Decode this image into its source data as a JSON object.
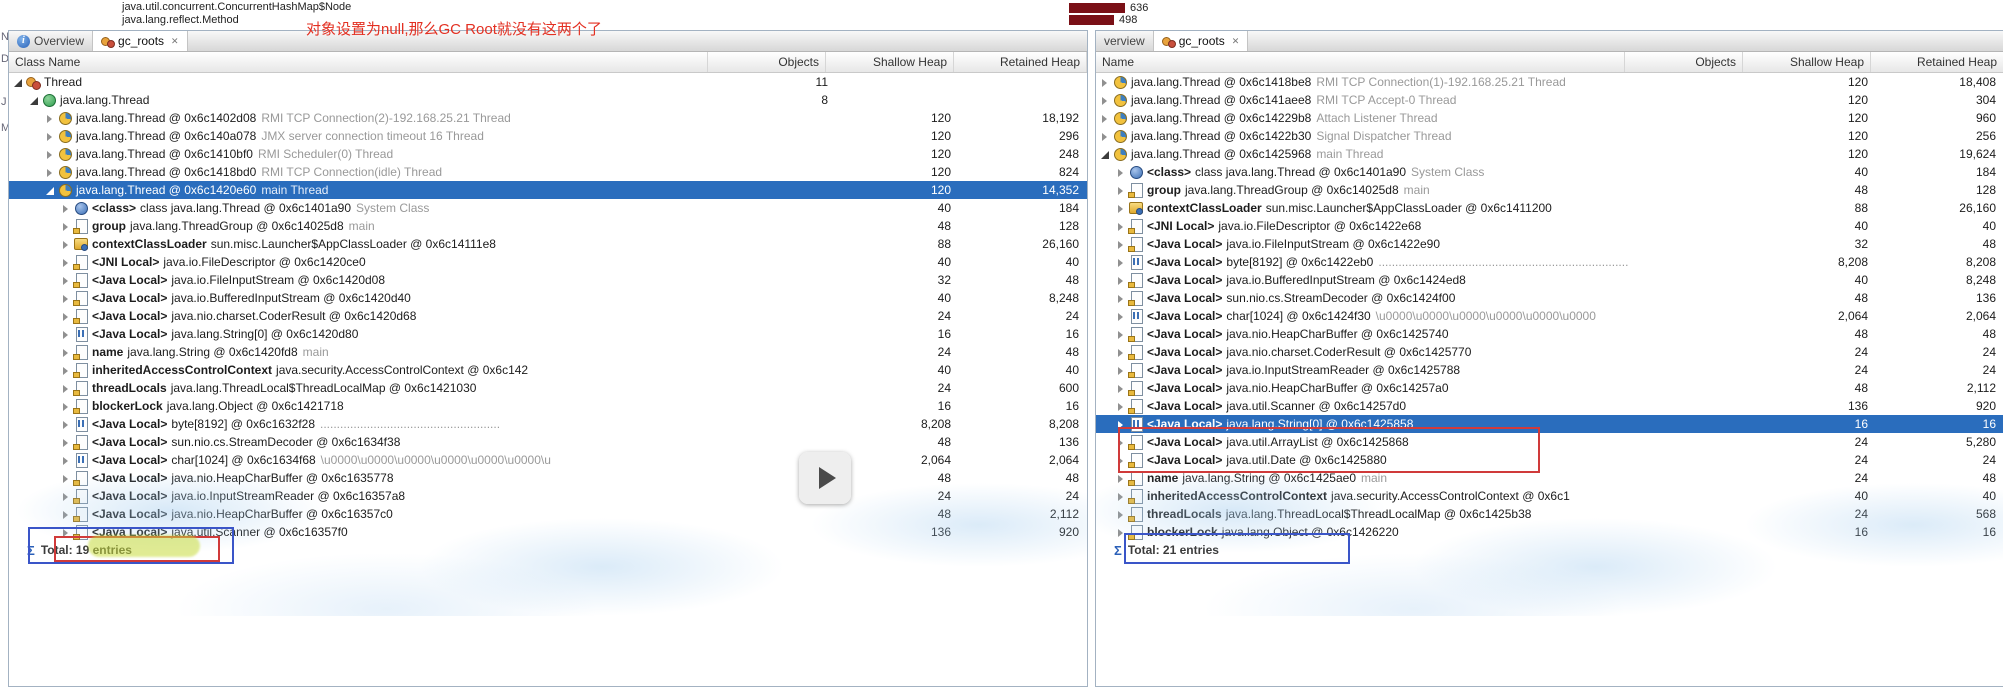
{
  "colors": {
    "selection": "#2a6dbd",
    "annotation_red": "#d03a3a",
    "annotation_blue": "#3a55c8",
    "highlight": "#c8dc3c",
    "bar": "#7a1016"
  },
  "glyphs": {
    "close": "✕",
    "sigma": "Σ"
  },
  "top_strip": {
    "overflow_rows": [
      "java.util.concurrent.ConcurrentHashMap$Node",
      "java.lang.reflect.Method"
    ],
    "annotation_cn": "对象设置为null,那么GC Root就没有这两个了",
    "histogram_bars": [
      {
        "value": "636"
      },
      {
        "value": "498"
      }
    ],
    "edge_letters": [
      "N",
      "D",
      "J",
      "M"
    ]
  },
  "left_panel": {
    "tabs": [
      {
        "label": "Overview",
        "icon": "info",
        "active": false,
        "closable": false
      },
      {
        "label": "gc_roots",
        "icon": "gcroots",
        "active": true,
        "closable": true
      }
    ],
    "columns": [
      "Class Name",
      "Objects",
      "Shallow Heap",
      "Retained Heap"
    ],
    "total_icon": "sigma",
    "total_label": "Total: 19 entries",
    "rows": [
      {
        "i": 0,
        "e": "e",
        "ic": "root",
        "t": "Thread",
        "o": "11"
      },
      {
        "i": 1,
        "e": "e",
        "ic": "jclass",
        "t": "java.lang.Thread",
        "o": "8"
      },
      {
        "i": 2,
        "e": "c",
        "ic": "thread",
        "t": "java.lang.Thread @ 0x6c1402d08",
        "s": "RMI TCP Connection(2)-192.168.25.21 Thread",
        "sh": "120",
        "rh": "18,192"
      },
      {
        "i": 2,
        "e": "c",
        "ic": "thread",
        "t": "java.lang.Thread @ 0x6c140a078",
        "s": "JMX server connection timeout 16 Thread",
        "sh": "120",
        "rh": "296"
      },
      {
        "i": 2,
        "e": "c",
        "ic": "thread",
        "t": "java.lang.Thread @ 0x6c1410bf0",
        "s": "RMI Scheduler(0) Thread",
        "sh": "120",
        "rh": "248"
      },
      {
        "i": 2,
        "e": "c",
        "ic": "thread",
        "t": "java.lang.Thread @ 0x6c1418bd0",
        "s": "RMI TCP Connection(idle) Thread",
        "sh": "120",
        "rh": "824"
      },
      {
        "i": 2,
        "e": "e",
        "ic": "thread",
        "t": "java.lang.Thread @ 0x6c1420e60",
        "s": "main Thread",
        "sel": true,
        "sh": "120",
        "rh": "14,352"
      },
      {
        "i": 3,
        "e": "c",
        "ic": "classref",
        "b": "<class>",
        "t": "class java.lang.Thread @ 0x6c1401a90",
        "s": "System Class",
        "sh": "40",
        "rh": "184"
      },
      {
        "i": 3,
        "e": "c",
        "ic": "page",
        "b": "group",
        "t": "java.lang.ThreadGroup @ 0x6c14025d8",
        "s": "main",
        "sh": "48",
        "rh": "128"
      },
      {
        "i": 3,
        "e": "c",
        "ic": "loader",
        "b": "contextClassLoader",
        "t": "sun.misc.Launcher$AppClassLoader @ 0x6c14111e8",
        "sh": "88",
        "rh": "26,160"
      },
      {
        "i": 3,
        "e": "c",
        "ic": "page",
        "b": "<JNI Local>",
        "t": "java.io.FileDescriptor @ 0x6c1420ce0",
        "sh": "40",
        "rh": "40"
      },
      {
        "i": 3,
        "e": "c",
        "ic": "page",
        "b": "<Java Local>",
        "t": "java.io.FileInputStream @ 0x6c1420d08",
        "sh": "32",
        "rh": "48"
      },
      {
        "i": 3,
        "e": "c",
        "ic": "page",
        "b": "<Java Local>",
        "t": "java.io.BufferedInputStream @ 0x6c1420d40",
        "sh": "40",
        "rh": "8,248"
      },
      {
        "i": 3,
        "e": "c",
        "ic": "page",
        "b": "<Java Local>",
        "t": "java.nio.charset.CoderResult @ 0x6c1420d68",
        "sh": "24",
        "rh": "24"
      },
      {
        "i": 3,
        "e": "c",
        "ic": "array",
        "b": "<Java Local>",
        "t": "java.lang.String[0] @ 0x6c1420d80",
        "sh": "16",
        "rh": "16"
      },
      {
        "i": 3,
        "e": "c",
        "ic": "page",
        "b": "name",
        "t": "java.lang.String @ 0x6c1420fd8",
        "s": "main",
        "sh": "24",
        "rh": "48"
      },
      {
        "i": 3,
        "e": "c",
        "ic": "page",
        "b": "inheritedAccessControlContext",
        "t": "java.security.AccessControlContext @ 0x6c142",
        "sh": "40",
        "rh": "40"
      },
      {
        "i": 3,
        "e": "c",
        "ic": "page",
        "b": "threadLocals",
        "t": "java.lang.ThreadLocal$ThreadLocalMap @ 0x6c1421030",
        "sh": "24",
        "rh": "600"
      },
      {
        "i": 3,
        "e": "c",
        "ic": "page",
        "b": "blockerLock",
        "t": "java.lang.Object @ 0x6c1421718",
        "sh": "16",
        "rh": "16"
      },
      {
        "i": 3,
        "e": "c",
        "ic": "array",
        "b": "<Java Local>",
        "t": "byte[8192] @ 0x6c1632f28",
        "s": "......................................................",
        "sh": "8,208",
        "rh": "8,208"
      },
      {
        "i": 3,
        "e": "c",
        "ic": "page",
        "b": "<Java Local>",
        "t": "sun.nio.cs.StreamDecoder @ 0x6c1634f38",
        "sh": "48",
        "rh": "136"
      },
      {
        "i": 3,
        "e": "c",
        "ic": "array",
        "b": "<Java Local>",
        "t": "char[1024] @ 0x6c1634f68",
        "s": "\\u0000\\u0000\\u0000\\u0000\\u0000\\u0000\\u",
        "sh": "2,064",
        "rh": "2,064"
      },
      {
        "i": 3,
        "e": "c",
        "ic": "page",
        "b": "<Java Local>",
        "t": "java.nio.HeapCharBuffer @ 0x6c1635778",
        "sh": "48",
        "rh": "48"
      },
      {
        "i": 3,
        "e": "c",
        "ic": "page",
        "b": "<Java Local>",
        "t": "java.io.InputStreamReader @ 0x6c16357a8",
        "sh": "24",
        "rh": "24"
      },
      {
        "i": 3,
        "e": "c",
        "ic": "page",
        "b": "<Java Local>",
        "t": "java.nio.HeapCharBuffer @ 0x6c16357c0",
        "sh": "48",
        "rh": "2,112"
      },
      {
        "i": 3,
        "e": "c",
        "ic": "page",
        "b": "<Java Local>",
        "t": "java.util.Scanner @ 0x6c16357f0",
        "sh": "136",
        "rh": "920"
      }
    ]
  },
  "right_panel": {
    "tabs": [
      {
        "label": "verview",
        "icon": "none",
        "active": false,
        "closable": false
      },
      {
        "label": "gc_roots",
        "icon": "gcroots",
        "active": true,
        "closable": true
      }
    ],
    "columns": [
      "Name",
      "Objects",
      "Shallow Heap",
      "Retained Heap"
    ],
    "total_icon": "sigma",
    "total_label": "Total: 21 entries",
    "rows": [
      {
        "i": 0,
        "e": "c",
        "ic": "thread",
        "t": "java.lang.Thread @ 0x6c1418be8",
        "s": "RMI TCP Connection(1)-192.168.25.21 Thread",
        "sh": "120",
        "rh": "18,408"
      },
      {
        "i": 0,
        "e": "c",
        "ic": "thread",
        "t": "java.lang.Thread @ 0x6c141aee8",
        "s": "RMI TCP Accept-0 Thread",
        "sh": "120",
        "rh": "304"
      },
      {
        "i": 0,
        "e": "c",
        "ic": "thread",
        "t": "java.lang.Thread @ 0x6c14229b8",
        "s": "Attach Listener Thread",
        "sh": "120",
        "rh": "960"
      },
      {
        "i": 0,
        "e": "c",
        "ic": "thread",
        "t": "java.lang.Thread @ 0x6c1422b30",
        "s": "Signal Dispatcher Thread",
        "sh": "120",
        "rh": "256"
      },
      {
        "i": 0,
        "e": "e",
        "ic": "thread",
        "t": "java.lang.Thread @ 0x6c1425968",
        "s": "main Thread",
        "sh": "120",
        "rh": "19,624"
      },
      {
        "i": 1,
        "e": "c",
        "ic": "classref",
        "b": "<class>",
        "t": "class java.lang.Thread @ 0x6c1401a90",
        "s": "System Class",
        "sh": "40",
        "rh": "184"
      },
      {
        "i": 1,
        "e": "c",
        "ic": "page",
        "b": "group",
        "t": "java.lang.ThreadGroup @ 0x6c14025d8",
        "s": "main",
        "sh": "48",
        "rh": "128"
      },
      {
        "i": 1,
        "e": "c",
        "ic": "loader",
        "b": "contextClassLoader",
        "t": "sun.misc.Launcher$AppClassLoader @ 0x6c1411200",
        "sh": "88",
        "rh": "26,160"
      },
      {
        "i": 1,
        "e": "c",
        "ic": "page",
        "b": "<JNI Local>",
        "t": "java.io.FileDescriptor @ 0x6c1422e68",
        "sh": "40",
        "rh": "40"
      },
      {
        "i": 1,
        "e": "c",
        "ic": "page",
        "b": "<Java Local>",
        "t": "java.io.FileInputStream @ 0x6c1422e90",
        "sh": "32",
        "rh": "48"
      },
      {
        "i": 1,
        "e": "c",
        "ic": "array",
        "b": "<Java Local>",
        "t": "byte[8192] @ 0x6c1422eb0",
        "s": "...........................................................................",
        "sh": "8,208",
        "rh": "8,208"
      },
      {
        "i": 1,
        "e": "c",
        "ic": "page",
        "b": "<Java Local>",
        "t": "java.io.BufferedInputStream @ 0x6c1424ed8",
        "sh": "40",
        "rh": "8,248"
      },
      {
        "i": 1,
        "e": "c",
        "ic": "page",
        "b": "<Java Local>",
        "t": "sun.nio.cs.StreamDecoder @ 0x6c1424f00",
        "sh": "48",
        "rh": "136"
      },
      {
        "i": 1,
        "e": "c",
        "ic": "array",
        "b": "<Java Local>",
        "t": "char[1024] @ 0x6c1424f30",
        "s": "\\u0000\\u0000\\u0000\\u0000\\u0000\\u0000",
        "sh": "2,064",
        "rh": "2,064"
      },
      {
        "i": 1,
        "e": "c",
        "ic": "page",
        "b": "<Java Local>",
        "t": "java.nio.HeapCharBuffer @ 0x6c1425740",
        "sh": "48",
        "rh": "48"
      },
      {
        "i": 1,
        "e": "c",
        "ic": "page",
        "b": "<Java Local>",
        "t": "java.nio.charset.CoderResult @ 0x6c1425770",
        "sh": "24",
        "rh": "24"
      },
      {
        "i": 1,
        "e": "c",
        "ic": "page",
        "b": "<Java Local>",
        "t": "java.io.InputStreamReader @ 0x6c1425788",
        "sh": "24",
        "rh": "24"
      },
      {
        "i": 1,
        "e": "c",
        "ic": "page",
        "b": "<Java Local>",
        "t": "java.nio.HeapCharBuffer @ 0x6c14257a0",
        "sh": "48",
        "rh": "2,112"
      },
      {
        "i": 1,
        "e": "c",
        "ic": "page",
        "b": "<Java Local>",
        "t": "java.util.Scanner @ 0x6c14257d0",
        "sh": "136",
        "rh": "920"
      },
      {
        "i": 1,
        "e": "c",
        "ic": "array",
        "b": "<Java Local>",
        "t": "java.lang.String[0] @ 0x6c1425858",
        "sel": true,
        "sh": "16",
        "rh": "16"
      },
      {
        "i": 1,
        "e": "c",
        "ic": "page",
        "b": "<Java Local>",
        "t": "java.util.ArrayList @ 0x6c1425868",
        "sh": "24",
        "rh": "5,280"
      },
      {
        "i": 1,
        "e": "c",
        "ic": "page",
        "b": "<Java Local>",
        "t": "java.util.Date @ 0x6c1425880",
        "sh": "24",
        "rh": "24"
      },
      {
        "i": 1,
        "e": "c",
        "ic": "page",
        "b": "name",
        "t": "java.lang.String @ 0x6c1425ae0",
        "s": "main",
        "sh": "24",
        "rh": "48"
      },
      {
        "i": 1,
        "e": "c",
        "ic": "page",
        "b": "inheritedAccessControlContext",
        "t": "java.security.AccessControlContext @ 0x6c1",
        "sh": "40",
        "rh": "40"
      },
      {
        "i": 1,
        "e": "c",
        "ic": "page",
        "b": "threadLocals",
        "t": "java.lang.ThreadLocal$ThreadLocalMap @ 0x6c1425b38",
        "sh": "24",
        "rh": "568"
      },
      {
        "i": 1,
        "e": "c",
        "ic": "page",
        "b": "blockerLock",
        "t": "java.lang.Object @ 0x6c1426220",
        "sh": "16",
        "rh": "16"
      }
    ]
  }
}
